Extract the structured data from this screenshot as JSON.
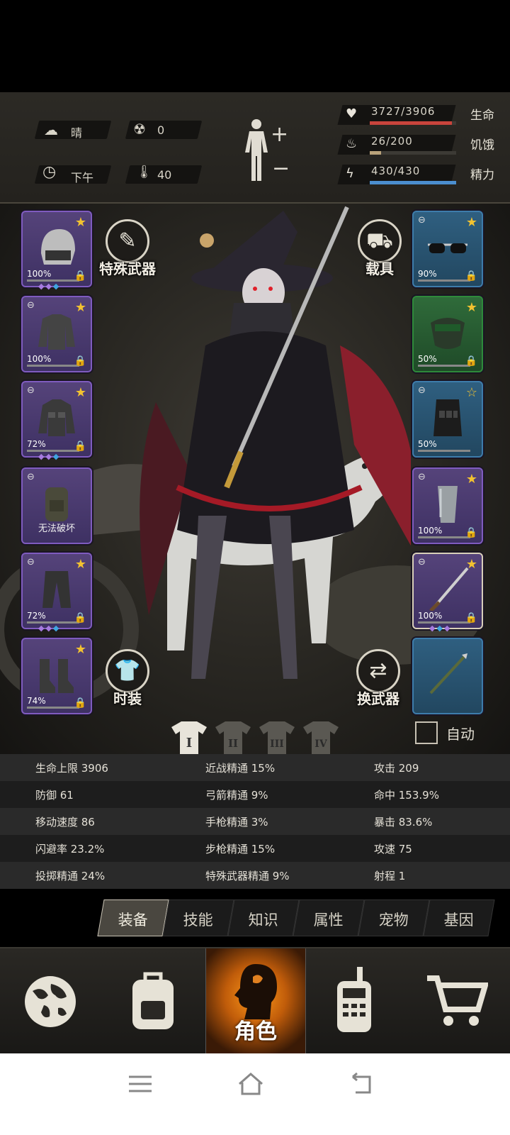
{
  "status": {
    "weather": "晴",
    "radiation": "0",
    "time_of_day": "下午",
    "temperature": "40",
    "health": {
      "value": "3727/3906",
      "label": "生命",
      "fraction": 0.954,
      "color": "#c9443c"
    },
    "hunger": {
      "value": "26/200",
      "label": "饥饿",
      "fraction": 0.13,
      "color": "#b9a27a"
    },
    "energy": {
      "value": "430/430",
      "label": "精力",
      "fraction": 1.0,
      "color": "#4b8ecf"
    }
  },
  "left_slots": [
    {
      "name": "helmet",
      "pct": "100%",
      "star": "★"
    },
    {
      "name": "shirt",
      "pct": "100%",
      "star": "★"
    },
    {
      "name": "jacket",
      "pct": "72%",
      "star": "★"
    },
    {
      "name": "backpack",
      "label": "无法破坏"
    },
    {
      "name": "pants",
      "pct": "72%",
      "star": "★"
    },
    {
      "name": "boots",
      "pct": "74%",
      "star": "★"
    }
  ],
  "right_slots": [
    {
      "name": "glasses",
      "pct": "90%",
      "star": "★"
    },
    {
      "name": "mask",
      "pct": "50%",
      "star": "★"
    },
    {
      "name": "vest",
      "pct": "50%",
      "star": "☆"
    },
    {
      "name": "bracer",
      "pct": "100%",
      "star": "★"
    },
    {
      "name": "katana",
      "pct": "100%",
      "star": "★"
    },
    {
      "name": "spear"
    }
  ],
  "buttons": {
    "special_weapon": "特殊武器",
    "vehicle": "载具",
    "fashion": "时装",
    "swap_weapon": "换武器",
    "auto": "自动"
  },
  "loadouts": [
    "I",
    "II",
    "III",
    "IV"
  ],
  "attributes": [
    [
      "生命上限 3906",
      "近战精通 15%",
      "攻击 209"
    ],
    [
      "防御 61",
      "弓箭精通 9%",
      "命中 153.9%"
    ],
    [
      "移动速度 86",
      "手枪精通 3%",
      "暴击 83.6%"
    ],
    [
      "闪避率 23.2%",
      "步枪精通 15%",
      "攻速 75"
    ],
    [
      "投掷精通 24%",
      "特殊武器精通 9%",
      "射程 1"
    ]
  ],
  "tabs": [
    "装备",
    "技能",
    "知识",
    "属性",
    "宠物",
    "基因"
  ],
  "nav": {
    "character": "角色"
  }
}
